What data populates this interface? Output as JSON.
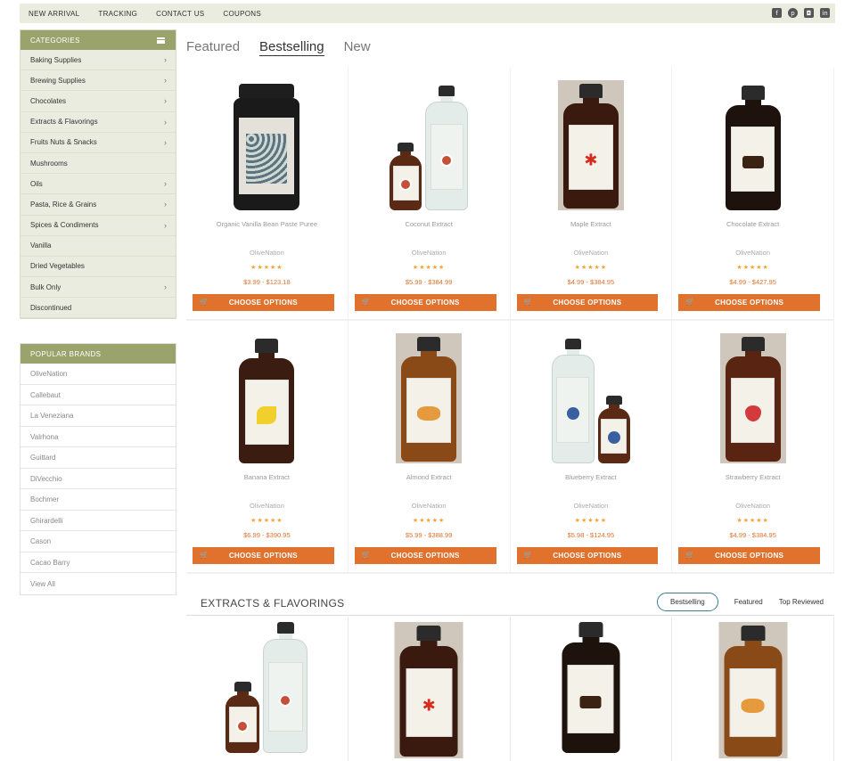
{
  "topnav": [
    "NEW ARRIVAL",
    "TRACKING",
    "CONTACT US",
    "COUPONS"
  ],
  "social_icons": [
    "facebook-icon",
    "pinterest-icon",
    "instagram-icon",
    "linkedin-icon"
  ],
  "categories": {
    "title": "CATEGORIES",
    "items": [
      {
        "label": "Baking Supplies",
        "chevron": true
      },
      {
        "label": "Brewing Supplies",
        "chevron": true
      },
      {
        "label": "Chocolates",
        "chevron": true
      },
      {
        "label": "Extracts & Flavorings",
        "chevron": true
      },
      {
        "label": "Fruits Nuts & Snacks",
        "chevron": true
      },
      {
        "label": "Mushrooms",
        "chevron": false
      },
      {
        "label": "Oils",
        "chevron": true
      },
      {
        "label": "Pasta, Rice & Grains",
        "chevron": true
      },
      {
        "label": "Spices & Condiments",
        "chevron": true
      },
      {
        "label": "Vanilla",
        "chevron": false
      },
      {
        "label": "Dried Vegetables",
        "chevron": false
      },
      {
        "label": "Bulk Only",
        "chevron": true
      },
      {
        "label": "Discontinued",
        "chevron": false
      }
    ]
  },
  "brands": {
    "title": "POPULAR BRANDS",
    "items": [
      "OliveNation",
      "Callebaut",
      "La Veneziana",
      "Valrhona",
      "Guittard",
      "DiVecchio",
      "Bochmer",
      "Ghirardelli",
      "Cason",
      "Cacao Barry",
      "View All"
    ]
  },
  "tabs": [
    {
      "label": "Featured",
      "active": false
    },
    {
      "label": "Bestselling",
      "active": true
    },
    {
      "label": "New",
      "active": false
    }
  ],
  "products": [
    {
      "name": "Organic Vanilla Bean Paste Puree",
      "brand": "OliveNation",
      "stars": "★★★★★",
      "price": "$3.99 - $123.18",
      "button": "CHOOSE OPTIONS",
      "image": "jar"
    },
    {
      "name": "Coconut Extract",
      "brand": "OliveNation",
      "stars": "★★★★★",
      "price": "$5.99 - $384.99",
      "button": "CHOOSE OPTIONS",
      "image": "coconut"
    },
    {
      "name": "Maple Extract",
      "brand": "OliveNation",
      "stars": "★★★★★",
      "price": "$4.99 - $384.95",
      "button": "CHOOSE OPTIONS",
      "image": "maple"
    },
    {
      "name": "Chocolate Extract",
      "brand": "OliveNation",
      "stars": "★★★★★",
      "price": "$4.99 - $427.95",
      "button": "CHOOSE OPTIONS",
      "image": "chocolate"
    },
    {
      "name": "Banana Extract",
      "brand": "OliveNation",
      "stars": "★★★★★",
      "price": "$6.99 - $390.95",
      "button": "CHOOSE OPTIONS",
      "image": "banana"
    },
    {
      "name": "Almond Extract",
      "brand": "OliveNation",
      "stars": "★★★★★",
      "price": "$5.99 - $388.99",
      "button": "CHOOSE OPTIONS",
      "image": "almond"
    },
    {
      "name": "Blueberry Extract",
      "brand": "OliveNation",
      "stars": "★★★★★",
      "price": "$5.98 - $124.95",
      "button": "CHOOSE OPTIONS",
      "image": "blueberry"
    },
    {
      "name": "Strawberry Extract",
      "brand": "OliveNation",
      "stars": "★★★★★",
      "price": "$4.99 - $384.95",
      "button": "CHOOSE OPTIONS",
      "image": "strawberry"
    }
  ],
  "section": {
    "title": "EXTRACTS & FLAVORINGS",
    "tabs": [
      {
        "label": "Bestselling",
        "active": true
      },
      {
        "label": "Featured",
        "active": false
      },
      {
        "label": "Top Reviewed",
        "active": false
      }
    ]
  },
  "section_products": [
    "coconut",
    "maple",
    "chocolate",
    "almond"
  ],
  "colors": {
    "accent_orange": "#e0722e",
    "olive_header": "#9aa36b",
    "sidebar_bg": "#e9ecdf",
    "star": "#f2a33a",
    "tab_outline": "#3a7e8c"
  }
}
